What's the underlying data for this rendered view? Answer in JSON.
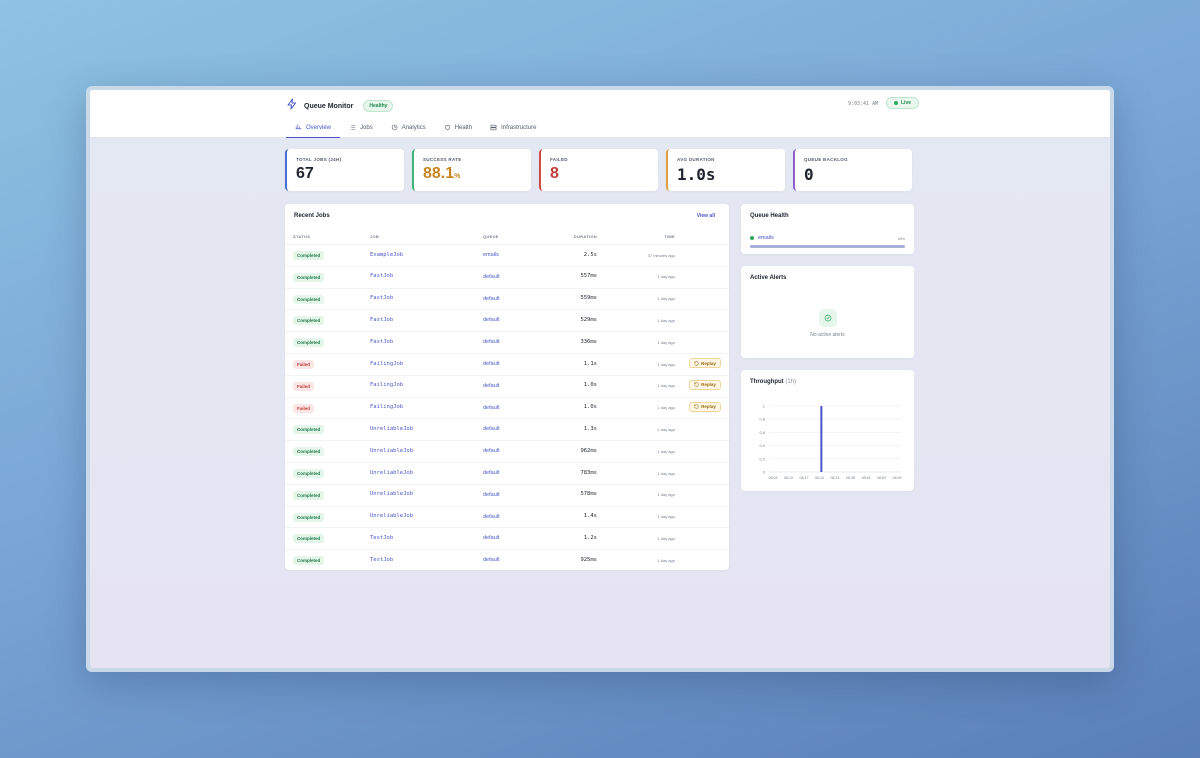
{
  "header": {
    "app_title": "Queue Monitor",
    "health_badge": "Healthy",
    "clock": "9:03:41 AM",
    "live_label": "Live"
  },
  "tabs": [
    {
      "label": "Overview",
      "icon": "bar-chart-icon"
    },
    {
      "label": "Jobs",
      "icon": "list-icon"
    },
    {
      "label": "Analytics",
      "icon": "pie-chart-icon"
    },
    {
      "label": "Health",
      "icon": "heart-icon"
    },
    {
      "label": "Infrastructure",
      "icon": "server-icon"
    }
  ],
  "stats": [
    {
      "label": "TOTAL JOBS (24H)",
      "value": "67",
      "unit": "",
      "color": "#4a6fd0",
      "value_color": "#1f2430"
    },
    {
      "label": "SUCCESS RATE",
      "value": "88.1",
      "unit": "%",
      "color": "#3fb37a",
      "value_color": "#c98422"
    },
    {
      "label": "FAILED",
      "value": "8",
      "unit": "",
      "color": "#d04a4a",
      "value_color": "#c23b3b"
    },
    {
      "label": "AVG DURATION",
      "value": "1.0s",
      "unit": "",
      "color": "#e0a040",
      "value_color": "#1f2430"
    },
    {
      "label": "QUEUE BACKLOG",
      "value": "0",
      "unit": "",
      "color": "#8a5fd0",
      "value_color": "#1f2430"
    }
  ],
  "recent_jobs": {
    "title": "Recent Jobs",
    "view_all": "View all",
    "columns": [
      "STATUS",
      "JOB",
      "QUEUE",
      "DURATION",
      "TIME"
    ],
    "replay_label": "Replay",
    "rows": [
      {
        "status": "Completed",
        "job": "ExampleJob",
        "queue": "emails",
        "duration": "2.5s",
        "time": "37 minutes ago"
      },
      {
        "status": "Completed",
        "job": "FastJob",
        "queue": "default",
        "duration": "557ms",
        "time": "1 day ago"
      },
      {
        "status": "Completed",
        "job": "FastJob",
        "queue": "default",
        "duration": "559ms",
        "time": "1 day ago"
      },
      {
        "status": "Completed",
        "job": "FastJob",
        "queue": "default",
        "duration": "529ms",
        "time": "1 day ago"
      },
      {
        "status": "Completed",
        "job": "FastJob",
        "queue": "default",
        "duration": "336ms",
        "time": "1 day ago"
      },
      {
        "status": "Failed",
        "job": "FailingJob",
        "queue": "default",
        "duration": "1.1s",
        "time": "1 day ago"
      },
      {
        "status": "Failed",
        "job": "FailingJob",
        "queue": "default",
        "duration": "1.0s",
        "time": "1 day ago"
      },
      {
        "status": "Failed",
        "job": "FailingJob",
        "queue": "default",
        "duration": "1.0s",
        "time": "1 day ago"
      },
      {
        "status": "Completed",
        "job": "UnreliableJob",
        "queue": "default",
        "duration": "1.3s",
        "time": "1 day ago"
      },
      {
        "status": "Completed",
        "job": "UnreliableJob",
        "queue": "default",
        "duration": "962ms",
        "time": "1 day ago"
      },
      {
        "status": "Completed",
        "job": "UnreliableJob",
        "queue": "default",
        "duration": "783ms",
        "time": "1 day ago"
      },
      {
        "status": "Completed",
        "job": "UnreliableJob",
        "queue": "default",
        "duration": "578ms",
        "time": "1 day ago"
      },
      {
        "status": "Completed",
        "job": "UnreliableJob",
        "queue": "default",
        "duration": "1.4s",
        "time": "1 day ago"
      },
      {
        "status": "Completed",
        "job": "TestJob",
        "queue": "default",
        "duration": "1.2s",
        "time": "1 day ago"
      },
      {
        "status": "Completed",
        "job": "TestJob",
        "queue": "default",
        "duration": "925ms",
        "time": "1 day ago"
      }
    ]
  },
  "queue_health": {
    "title": "Queue Health",
    "queues": [
      {
        "name": "emails",
        "value": "0/hr",
        "fill": 1.0
      }
    ]
  },
  "alerts": {
    "title": "Active Alerts",
    "empty_text": "No active alerts"
  },
  "throughput": {
    "title": "Throughput",
    "unit": "(1h)"
  },
  "chart_data": {
    "type": "bar",
    "categories": [
      "08:03",
      "08:10",
      "08:17",
      "08:24",
      "08:31",
      "08:38",
      "08:45",
      "08:52",
      "08:59"
    ],
    "x_bar_position": "08:25",
    "values": [
      0,
      0,
      0,
      1,
      0,
      0,
      0,
      0,
      0
    ],
    "yticks": [
      "0",
      "0.2",
      "0.4",
      "0.6",
      "0.8",
      "1"
    ],
    "ylim": [
      0,
      1
    ],
    "bar_color": "#4a56c8",
    "grid": true,
    "title": "Throughput",
    "xlabel": "",
    "ylabel": ""
  }
}
